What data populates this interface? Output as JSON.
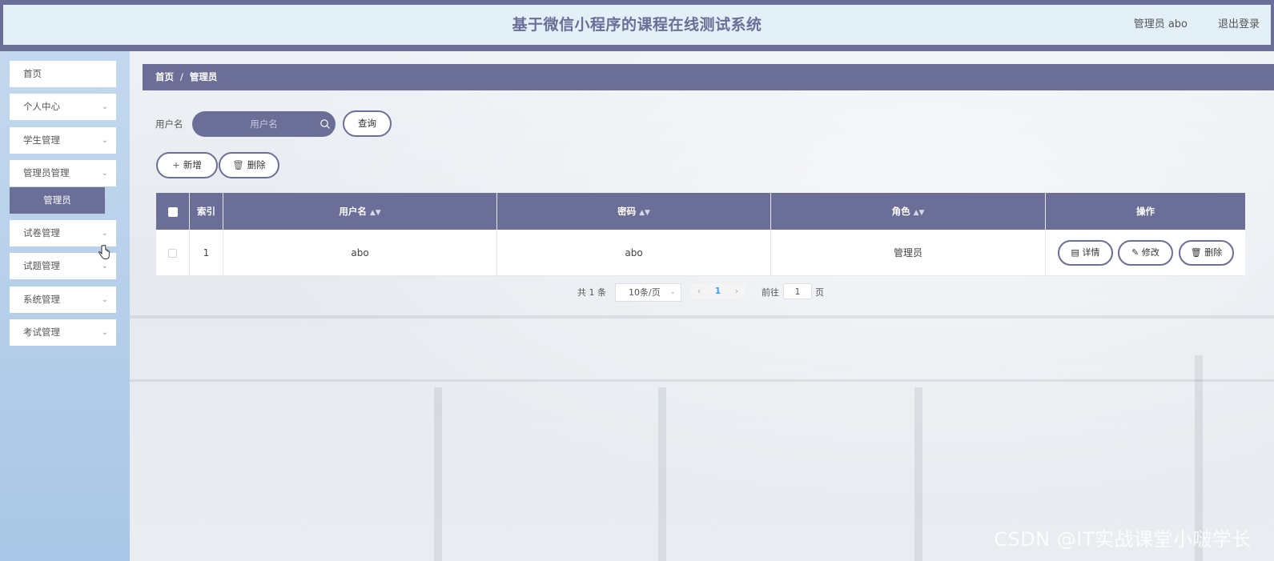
{
  "header": {
    "title": "基于微信小程序的课程在线测试系统",
    "user_label": "管理员 abo",
    "logout_label": "退出登录"
  },
  "sidebar": {
    "items": [
      {
        "label": "首页",
        "has_chevron": false
      },
      {
        "label": "个人中心",
        "has_chevron": true
      },
      {
        "label": "学生管理",
        "has_chevron": true
      },
      {
        "label": "管理员管理",
        "has_chevron": true
      },
      {
        "label": "试卷管理",
        "has_chevron": true
      },
      {
        "label": "试题管理",
        "has_chevron": true
      },
      {
        "label": "系统管理",
        "has_chevron": true
      },
      {
        "label": "考试管理",
        "has_chevron": true
      }
    ],
    "active_sub_item": "管理员"
  },
  "breadcrumb": {
    "home": "首页",
    "separator": "/",
    "current": "管理员"
  },
  "search": {
    "label": "用户名",
    "placeholder": "用户名",
    "button_label": "查询"
  },
  "toolbar": {
    "add_label": "新增",
    "delete_label": "删除"
  },
  "table": {
    "columns": [
      "索引",
      "用户名",
      "密码",
      "角色",
      "操作"
    ],
    "rows": [
      {
        "index": "1",
        "username": "abo",
        "password": "abo",
        "role": "管理员",
        "actions": [
          "详情",
          "修改",
          "删除"
        ]
      }
    ]
  },
  "pagination": {
    "total_text": "共 1 条",
    "page_size": "10条/页",
    "current_page": "1",
    "goto_label": "前往",
    "goto_value": "1",
    "page_suffix": "页"
  },
  "watermark": "CSDN @IT实战课堂小啵学长",
  "colors": {
    "accent": "#6b6e96",
    "header_bg": "#e3f0f8",
    "sidebar_bg": "#b5cfe9"
  }
}
